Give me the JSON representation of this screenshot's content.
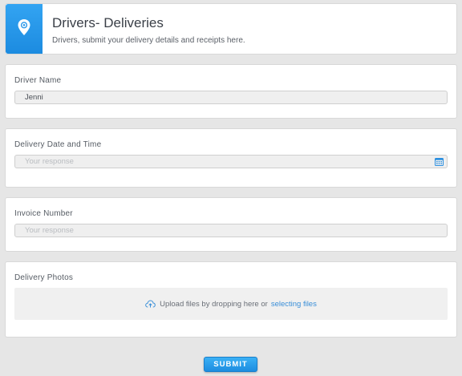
{
  "header": {
    "title": "Drivers- Deliveries",
    "subtitle": "Drivers, submit your delivery details and receipts here.",
    "icon": "location-pin-icon",
    "accent": "#2196f3"
  },
  "fields": {
    "driver_name": {
      "label": "Driver Name",
      "value": "Jenni"
    },
    "delivery_datetime": {
      "label": "Delivery Date and Time",
      "placeholder": "Your response",
      "icon": "calendar-icon"
    },
    "invoice_number": {
      "label": "Invoice Number",
      "placeholder": "Your response"
    },
    "delivery_photos": {
      "label": "Delivery Photos",
      "upload_text": "Upload files by dropping here or",
      "upload_link": "selecting files",
      "icon": "cloud-upload-icon"
    }
  },
  "submit_label": "SUBMIT"
}
